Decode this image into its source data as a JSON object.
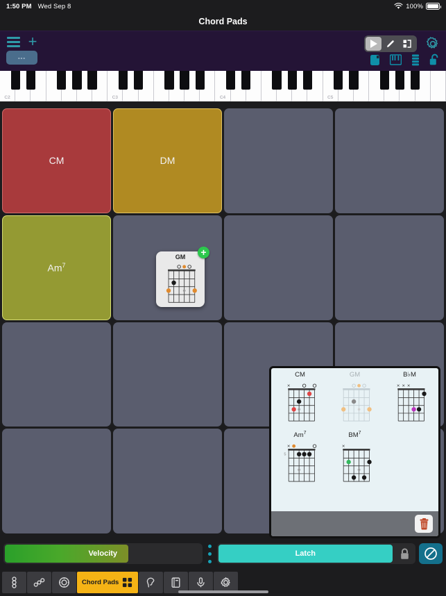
{
  "status_bar": {
    "time": "1:50 PM",
    "date": "Wed Sep 8",
    "battery_percent": "100%",
    "wifi_icon": "wifi-icon",
    "battery_icon": "battery-full-icon"
  },
  "header": {
    "title": "Chord Pads"
  },
  "toolbar": {
    "menu_icon": "hamburger-menu-icon",
    "add_icon": "plus-icon",
    "preset_label": "---",
    "segment": [
      {
        "icon": "play-icon",
        "active": true
      },
      {
        "icon": "pencil-icon",
        "active": false
      },
      {
        "icon": "layout-split-icon",
        "active": false
      }
    ],
    "settings_icon": "gear-icon",
    "row2": [
      {
        "icon": "pad-square-icon"
      },
      {
        "icon": "keyboard-icon"
      },
      {
        "icon": "strips-icon"
      },
      {
        "icon": "unlock-icon"
      }
    ]
  },
  "keyboard": {
    "octave_labels": [
      "C2",
      "C3",
      "C4",
      "C5"
    ],
    "white_key_count": 29
  },
  "pads": [
    {
      "label": "CM",
      "sup": "",
      "color": "#a83a3c",
      "border": "#d06a6a",
      "filled": true
    },
    {
      "label": "DM",
      "sup": "",
      "color": "#b08a22",
      "border": "#e0c260",
      "filled": true
    },
    {
      "label": "",
      "sup": "",
      "color": "#5a5d6e",
      "border": "",
      "filled": false
    },
    {
      "label": "",
      "sup": "",
      "color": "#5a5d6e",
      "border": "",
      "filled": false
    },
    {
      "label": "Am",
      "sup": "7",
      "color": "#949a33",
      "border": "#d6dd72",
      "filled": true
    },
    {
      "label": "",
      "sup": "",
      "color": "#5a5d6e",
      "border": "",
      "filled": false
    },
    {
      "label": "",
      "sup": "",
      "color": "#5a5d6e",
      "border": "",
      "filled": false
    },
    {
      "label": "",
      "sup": "",
      "color": "#5a5d6e",
      "border": "",
      "filled": false
    },
    {
      "label": "",
      "sup": "",
      "color": "#5a5d6e",
      "border": "",
      "filled": false
    },
    {
      "label": "",
      "sup": "",
      "color": "#5a5d6e",
      "border": "",
      "filled": false
    },
    {
      "label": "",
      "sup": "",
      "color": "#5a5d6e",
      "border": "",
      "filled": false
    },
    {
      "label": "",
      "sup": "",
      "color": "#5a5d6e",
      "border": "",
      "filled": false
    },
    {
      "label": "",
      "sup": "",
      "color": "#5a5d6e",
      "border": "",
      "filled": false
    },
    {
      "label": "",
      "sup": "",
      "color": "#5a5d6e",
      "border": "",
      "filled": false
    },
    {
      "label": "",
      "sup": "",
      "color": "#5a5d6e",
      "border": "",
      "filled": false
    },
    {
      "label": "",
      "sup": "",
      "color": "#5a5d6e",
      "border": "",
      "filled": false
    }
  ],
  "drag_card": {
    "chord_name": "GM",
    "badge": "+",
    "badge_color": "#2cc84d",
    "open_markers": [
      "o",
      "dot",
      "o"
    ],
    "dots": [
      {
        "string": 1,
        "fret": 2,
        "color": "#1a1a1a"
      },
      {
        "string": 0,
        "fret": 3,
        "color": "#e08a2e"
      },
      {
        "string": 3,
        "fret": 3,
        "color": "#9a9a9a"
      },
      {
        "string": 5,
        "fret": 3,
        "color": "#e08a2e"
      }
    ]
  },
  "library": {
    "chords": [
      {
        "name": "CM",
        "sup": "",
        "dimmed": false,
        "fret_label": "",
        "top_markers": [
          "x",
          "",
          "",
          "o",
          "",
          "o"
        ],
        "dots": [
          {
            "string": 4,
            "fret": 1,
            "color": "#e04545"
          },
          {
            "string": 2,
            "fret": 2,
            "color": "#1a1a1a"
          },
          {
            "string": 1,
            "fret": 3,
            "color": "#e04545"
          },
          {
            "string": 2,
            "fret": 3,
            "color": "#9a9a9a"
          }
        ]
      },
      {
        "name": "GM",
        "sup": "",
        "dimmed": true,
        "fret_label": "",
        "top_markers": [
          "",
          "",
          "o",
          "dot",
          "o",
          ""
        ],
        "dots": [
          {
            "string": 2,
            "fret": 2,
            "color": "#8a8a8a"
          },
          {
            "string": 0,
            "fret": 3,
            "color": "#f0c083"
          },
          {
            "string": 3,
            "fret": 3,
            "color": "#cfcfcf"
          },
          {
            "string": 5,
            "fret": 3,
            "color": "#f0c083"
          }
        ]
      },
      {
        "name": "B",
        "sup": "",
        "accidental": "♭",
        "suffix": "M",
        "dimmed": false,
        "fret_label": "",
        "top_markers": [
          "x",
          "x",
          "x",
          "",
          "",
          ""
        ],
        "dots": [
          {
            "string": 5,
            "fret": 1,
            "color": "#1a1a1a"
          },
          {
            "string": 3,
            "fret": 3,
            "color": "#bb35c0"
          },
          {
            "string": 4,
            "fret": 3,
            "color": "#1a1a1a"
          }
        ]
      },
      {
        "name": "Am",
        "sup": "7",
        "dimmed": false,
        "fret_label": "5",
        "top_markers": [
          "x",
          "dot",
          "",
          "",
          "",
          "o"
        ],
        "dots": [
          {
            "string": 2,
            "fret": 1,
            "color": "#1a1a1a"
          },
          {
            "string": 3,
            "fret": 1,
            "color": "#1a1a1a"
          },
          {
            "string": 4,
            "fret": 1,
            "color": "#1a1a1a"
          },
          {
            "string": 2,
            "fret": 3,
            "color": "#9a9a9a"
          }
        ]
      },
      {
        "name": "BM",
        "sup": "7",
        "dimmed": false,
        "fret_label": "",
        "top_markers": [
          "x",
          "",
          "",
          "",
          "",
          ""
        ],
        "dots": [
          {
            "string": 1,
            "fret": 2,
            "color": "#35b85e"
          },
          {
            "string": 5,
            "fret": 2,
            "color": "#1a1a1a"
          },
          {
            "string": 3,
            "fret": 3,
            "color": "#9a9a9a"
          },
          {
            "string": 2,
            "fret": 4,
            "color": "#1a1a1a"
          },
          {
            "string": 4,
            "fret": 4,
            "color": "#1a1a1a"
          }
        ]
      }
    ],
    "trash_icon": "trash-icon"
  },
  "controls": {
    "velocity_label": "Velocity",
    "velocity_fill_percent": 62,
    "latch_label": "Latch",
    "lock_icon": "lock-closed-icon",
    "mute_icon": "prohibited-circle-icon"
  },
  "tabbar": {
    "tabs": [
      {
        "icon": "chain-vertical-icon",
        "label": "",
        "active": false
      },
      {
        "icon": "chain-diagonal-icon",
        "label": "",
        "active": false
      },
      {
        "icon": "circle-dotted-icon",
        "label": "",
        "active": false
      },
      {
        "icon": "grid-pads-icon",
        "label": "Chord Pads",
        "active": true
      },
      {
        "icon": "ear-icon",
        "label": "",
        "active": false
      },
      {
        "icon": "book-icon",
        "label": "",
        "active": false
      },
      {
        "icon": "microphone-icon",
        "label": "",
        "active": false
      },
      {
        "icon": "gear-icon",
        "label": "",
        "active": false
      }
    ]
  },
  "colors": {
    "toolbar_bg": "#241436",
    "accent_teal": "#2f9aa8",
    "pad_empty": "#5a5d6e",
    "tab_active": "#f5b315",
    "latch": "#35cfc4"
  }
}
